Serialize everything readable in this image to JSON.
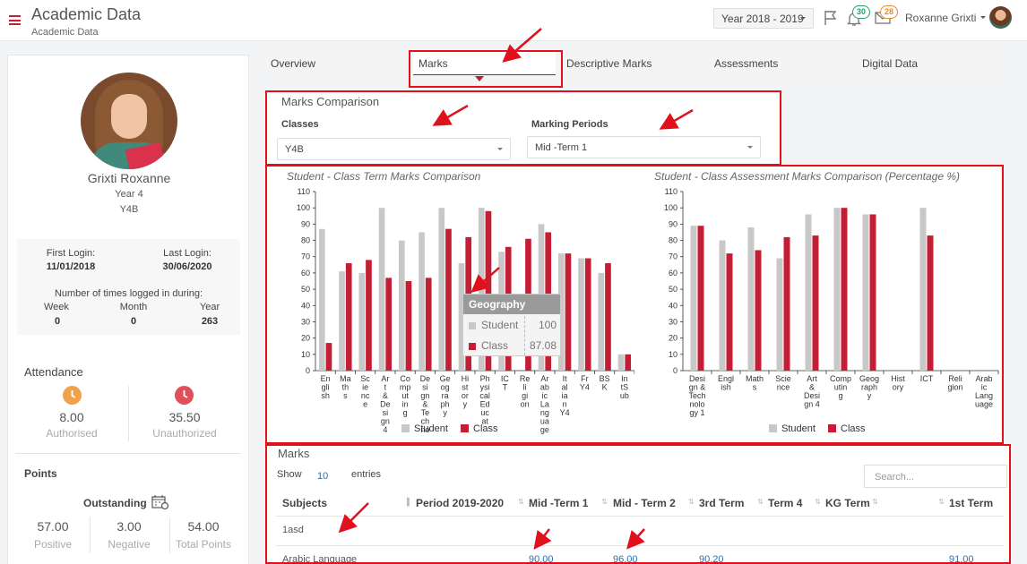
{
  "header": {
    "title": "Academic Data",
    "subtitle": "Academic Data",
    "year_selector": "Year 2018 - 2019",
    "notifications_count": "30",
    "messages_count": "28",
    "user_name": "Roxanne Grixti"
  },
  "profile": {
    "name": "Grixti Roxanne",
    "year": "Year 4",
    "class": "Y4B",
    "first_login_label": "First Login:",
    "first_login_value": "11/01/2018",
    "last_login_label": "Last Login:",
    "last_login_value": "30/06/2020",
    "times_logged_label": "Number of times logged in during:",
    "week_label": "Week",
    "week_value": "0",
    "month_label": "Month",
    "month_value": "0",
    "year_label": "Year",
    "year_value": "263"
  },
  "attendance": {
    "title": "Attendance",
    "authorised_value": "8.00",
    "authorised_label": "Authorised",
    "unauthorized_value": "35.50",
    "unauthorized_label": "Unauthorized"
  },
  "points": {
    "title": "Points",
    "outstanding_label": "Outstanding",
    "positive_value": "57.00",
    "positive_label": "Positive",
    "negative_value": "3.00",
    "negative_label": "Negative",
    "total_value": "54.00",
    "total_label": "Total Points"
  },
  "tabs": [
    {
      "label": "Overview"
    },
    {
      "label": "Marks"
    },
    {
      "label": "Descriptive Marks"
    },
    {
      "label": "Assessments"
    },
    {
      "label": "Digital Data"
    }
  ],
  "comparison": {
    "title": "Marks Comparison",
    "classes_label": "Classes",
    "classes_value": "Y4B",
    "periods_label": "Marking Periods",
    "periods_value": "Mid -Term 1"
  },
  "tooltip": {
    "title": "Geography",
    "student_label": "Student",
    "student_value": "100",
    "class_label": "Class",
    "class_value": "87.08"
  },
  "marks_table": {
    "title": "Marks",
    "show_label": "Show",
    "entries_value": "10",
    "entries_label": "entries",
    "search_placeholder": "Search...",
    "columns": [
      "Subjects",
      "Period 2019-2020",
      "Mid -Term 1",
      "Mid - Term 2",
      "3rd Term",
      "Term 4",
      "KG Term",
      "1st Term"
    ],
    "rows": [
      {
        "subject": "1asd",
        "values": [
          "",
          "",
          "",
          "",
          "",
          "",
          ""
        ]
      },
      {
        "subject": "Arabic Language",
        "values": [
          "",
          "90.00",
          "96.00",
          "90.20",
          "",
          "",
          "91.00"
        ]
      }
    ]
  },
  "colors": {
    "student": "#c8c8c8",
    "class": "#c41e35",
    "highlight": "#e0101c",
    "accent": "#9a2030"
  },
  "chart_data": [
    {
      "type": "bar",
      "title": "Student - Class Term Marks Comparison",
      "categories": [
        "English",
        "Maths",
        "Science",
        "Art & Design 4",
        "Computing",
        "Design & Techno",
        "Geography",
        "History",
        "Physical Education",
        "ICT",
        "Religion",
        "Arabic Language",
        "Italian Y4",
        "Fr Y4",
        "BSK",
        "IntSub"
      ],
      "tick_labels": [
        "En\ngli\nsh",
        "Ma\nth\ns",
        "Sc\nie\nnc\ne",
        "Ar\nt\n&\nDe\nsi\ngn\n4",
        "Co\nmp\nut\nin\ng",
        "De\nsi\ngn\n&\nTe\nch\nno",
        "Ge\nog\nra\nph\ny",
        "Hi\nst\nor\ny",
        "Ph\nysi\ncal\nEd\nuc\nat",
        "IC\nT",
        "Re\nli\ngi\non",
        "Ar\nab\nic\nLa\nng\nua\nge",
        "It\nal\nia\nn\nY4",
        "Fr\nY4",
        "BS\nK",
        "In\ntS\nub"
      ],
      "series": [
        {
          "name": "Student",
          "values": [
            87,
            61,
            60,
            100,
            80,
            85,
            100,
            66,
            100,
            73,
            0,
            90,
            72,
            69,
            60,
            10
          ]
        },
        {
          "name": "Class",
          "values": [
            17,
            66,
            68,
            57,
            55,
            57,
            87.08,
            82,
            98,
            76,
            81,
            85,
            72,
            69,
            66,
            10
          ]
        }
      ],
      "ylim": [
        0,
        110
      ],
      "yticks": [
        0,
        10,
        20,
        30,
        40,
        50,
        60,
        70,
        80,
        90,
        100,
        110
      ],
      "legend": "bottom"
    },
    {
      "type": "bar",
      "title": "Student - Class Assessment Marks Comparison (Percentage %)",
      "categories": [
        "Design & Technology 1",
        "English",
        "Maths",
        "Science",
        "Art & Design 4",
        "Computing",
        "Geography",
        "History",
        "ICT",
        "Religion",
        "Arabic Language"
      ],
      "tick_labels": [
        "Desi\ngn &\nTech\nnolo\ngy 1",
        "Engl\nish",
        "Math\ns",
        "Scie\nnce",
        "Art\n&\nDesi\ngn 4",
        "Comp\nutin\ng",
        "Geog\nraph\ny",
        "Hist\nory",
        "ICT",
        "Reli\ngion",
        "Arab\nic\nLang\nuage"
      ],
      "series": [
        {
          "name": "Student",
          "values": [
            89,
            80,
            88,
            69,
            96,
            100,
            96,
            0,
            100,
            0,
            0
          ]
        },
        {
          "name": "Class",
          "values": [
            89,
            72,
            74,
            82,
            83,
            100,
            96,
            0,
            83,
            0,
            0
          ]
        }
      ],
      "ylim": [
        0,
        110
      ],
      "yticks": [
        0,
        10,
        20,
        30,
        40,
        50,
        60,
        70,
        80,
        90,
        100,
        110
      ],
      "legend": "bottom"
    }
  ]
}
